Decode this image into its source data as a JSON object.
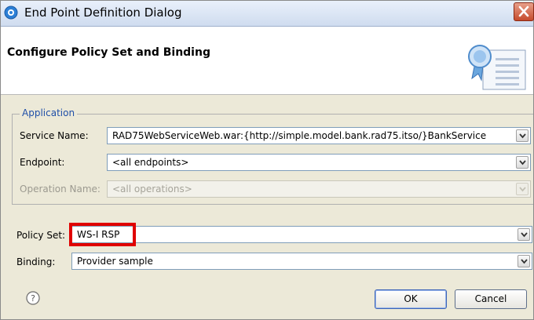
{
  "window": {
    "title": "End Point Definition Dialog"
  },
  "header": {
    "title": "Configure Policy Set and Binding"
  },
  "application_group": {
    "legend": "Application",
    "service_name_label": "Service Name:",
    "service_name_value": "RAD75WebServiceWeb.war:{http://simple.model.bank.rad75.itso/}BankService",
    "endpoint_label": "Endpoint:",
    "endpoint_value": "<all endpoints>",
    "operation_name_label": "Operation Name:",
    "operation_name_value": "<all operations>",
    "operation_name_enabled": false
  },
  "policy": {
    "policy_set_label": "Policy Set:",
    "policy_set_value": "WS-I RSP",
    "binding_label": "Binding:",
    "binding_value": "Provider sample"
  },
  "footer": {
    "ok_label": "OK",
    "cancel_label": "Cancel"
  },
  "colors": {
    "highlight": "#e00000",
    "group_legend": "#1f4fa8"
  },
  "icons": [
    "app-icon",
    "close-icon",
    "certificate-document-icon",
    "chevron-down-icon",
    "help-icon"
  ]
}
